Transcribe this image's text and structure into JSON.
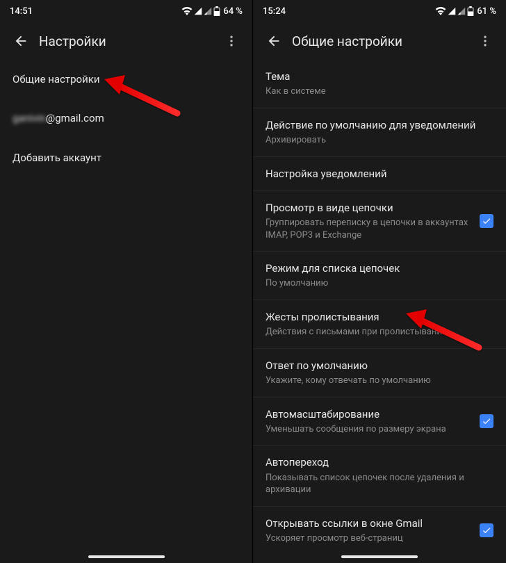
{
  "left": {
    "status": {
      "time": "14:51",
      "battery": "64 %"
    },
    "title": "Настройки",
    "items": [
      {
        "title": "Общие настройки",
        "sub": null,
        "checked": null,
        "name": "sidebar-item-general",
        "blurred": false
      },
      {
        "title": "gаnіvіn@gmail.com",
        "sub": null,
        "checked": null,
        "name": "sidebar-item-account",
        "blurred": true
      },
      {
        "title": "Добавить аккаунт",
        "sub": null,
        "checked": null,
        "name": "sidebar-item-add-account",
        "blurred": false
      }
    ]
  },
  "right": {
    "status": {
      "time": "15:24",
      "battery": "61 %"
    },
    "title": "Общие настройки",
    "items": [
      {
        "title": "Тема",
        "sub": "Как в системе",
        "checked": null,
        "name": "setting-theme"
      },
      {
        "title": "Действие по умолчанию для уведомлений",
        "sub": "Архивировать",
        "checked": null,
        "name": "setting-default-notif-action"
      },
      {
        "title": "Настройка уведомлений",
        "sub": null,
        "checked": null,
        "name": "setting-manage-notifs"
      },
      {
        "title": "Просмотр в виде цепочки",
        "sub": "Группировать переписку в цепочки в аккаунтах IMAP, POP3 и Exchange",
        "checked": true,
        "name": "setting-conversation-view"
      },
      {
        "title": "Режим для списка цепочек",
        "sub": "По умолчанию",
        "checked": null,
        "name": "setting-conversation-list-density"
      },
      {
        "title": "Жесты пролистывания",
        "sub": "Действия с письмами при пролистывании",
        "checked": null,
        "name": "setting-swipe-actions"
      },
      {
        "title": "Ответ по умолчанию",
        "sub": "Укажите, кому отвечать по умолчанию",
        "checked": null,
        "name": "setting-default-reply"
      },
      {
        "title": "Автомасштабирование",
        "sub": "Уменьшать сообщения по размеру экрана",
        "checked": true,
        "name": "setting-auto-fit"
      },
      {
        "title": "Автопереход",
        "sub": "Показывать список цепочек после удаления и архивации",
        "checked": null,
        "name": "setting-auto-advance"
      },
      {
        "title": "Открывать ссылки в окне Gmail",
        "sub": "Ускоряет просмотр веб-страниц",
        "checked": true,
        "name": "setting-open-links-in-gmail"
      }
    ]
  }
}
